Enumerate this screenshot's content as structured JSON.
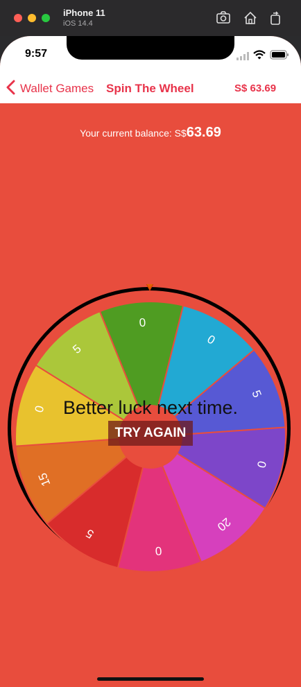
{
  "simulator": {
    "device_name": "iPhone 11",
    "os_version": "iOS 14.4",
    "buttons": [
      "screenshot-icon",
      "home-icon",
      "rotate-icon"
    ]
  },
  "status_bar": {
    "time": "9:57",
    "icons": [
      "signal-icon",
      "wifi-icon",
      "battery-icon"
    ]
  },
  "nav": {
    "back_label": "Wallet Games",
    "title": "Spin The Wheel",
    "balance": "S$ 63.69"
  },
  "balance": {
    "label": "Your current balance: S$",
    "value": "63.69"
  },
  "wheel": {
    "pointer": "pointer-icon",
    "segments": [
      {
        "label": "0",
        "color": "#4f9c22"
      },
      {
        "label": "0",
        "color": "#22a9d3"
      },
      {
        "label": "5",
        "color": "#5759d4"
      },
      {
        "label": "0",
        "color": "#7d46c9"
      },
      {
        "label": "20",
        "color": "#d640bd"
      },
      {
        "label": "0",
        "color": "#e3337b"
      },
      {
        "label": "5",
        "color": "#d82c2c"
      },
      {
        "label": "15",
        "color": "#e06f25"
      },
      {
        "label": "0",
        "color": "#e8c22e"
      },
      {
        "label": "5",
        "color": "#abc73a"
      }
    ]
  },
  "result": {
    "message": "Better luck next time.",
    "button": "TRY AGAIN"
  },
  "colors": {
    "accent": "#e8334a",
    "background": "#e84d3d"
  }
}
